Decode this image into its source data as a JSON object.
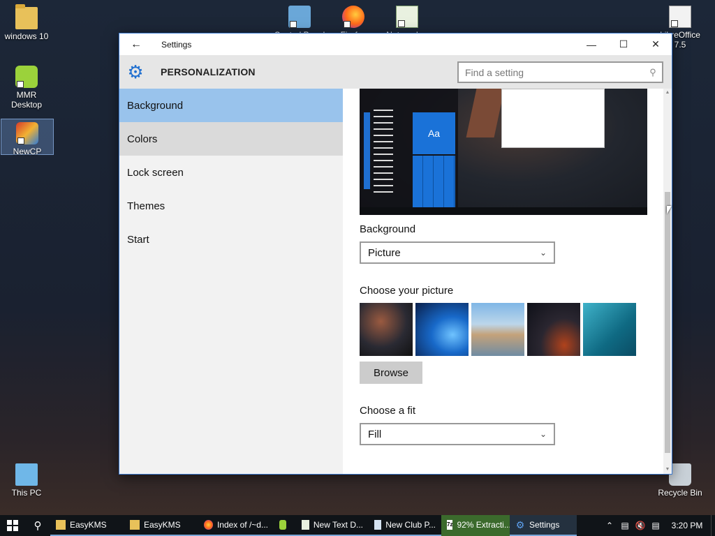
{
  "desktop": {
    "icons": [
      {
        "label": "windows 10"
      },
      {
        "label": "MMR Desktop"
      },
      {
        "label": "NewCP"
      },
      {
        "label": "This PC"
      },
      {
        "label": "Recycle Bin"
      },
      {
        "label": "Control Panel"
      },
      {
        "label": "Firefox"
      },
      {
        "label": "Notepad++"
      },
      {
        "label": "LibreOffice 7.5"
      }
    ]
  },
  "window": {
    "title": "Settings",
    "back_icon": "arrow-left-icon",
    "controls": {
      "minimize": "—",
      "maximize": "☐",
      "close": "✕"
    }
  },
  "header": {
    "title": "PERSONALIZATION",
    "icon": "gear-icon",
    "search_placeholder": "Find a setting"
  },
  "sidebar": {
    "items": [
      {
        "label": "Background",
        "state": "selected"
      },
      {
        "label": "Colors",
        "state": "hover"
      },
      {
        "label": "Lock screen",
        "state": "normal"
      },
      {
        "label": "Themes",
        "state": "normal"
      },
      {
        "label": "Start",
        "state": "normal"
      }
    ]
  },
  "content": {
    "preview": {
      "tile_text": "Aa"
    },
    "background_label": "Background",
    "background_value": "Picture",
    "choose_picture_label": "Choose your picture",
    "browse_label": "Browse",
    "choose_fit_label": "Choose a fit",
    "fit_value": "Fill"
  },
  "taskbar": {
    "items": [
      {
        "label": "EasyKMS",
        "icon": "folder-icon"
      },
      {
        "label": "EasyKMS",
        "icon": "folder-icon"
      },
      {
        "label": "Index of /~d...",
        "icon": "firefox-icon"
      },
      {
        "label": "",
        "icon": "mmr-icon"
      },
      {
        "label": "New Text D...",
        "icon": "notepad-icon"
      },
      {
        "label": "New Club P...",
        "icon": "app-icon"
      },
      {
        "label": "92% Extracti...",
        "icon": "7zip-icon"
      },
      {
        "label": "Settings",
        "icon": "gear-icon"
      }
    ],
    "clock": "3:20 PM"
  },
  "colors": {
    "accent": "#1f6fd0",
    "selected_nav": "#99c3ec",
    "hover_nav": "#dadada",
    "taskbar": "#101418"
  }
}
